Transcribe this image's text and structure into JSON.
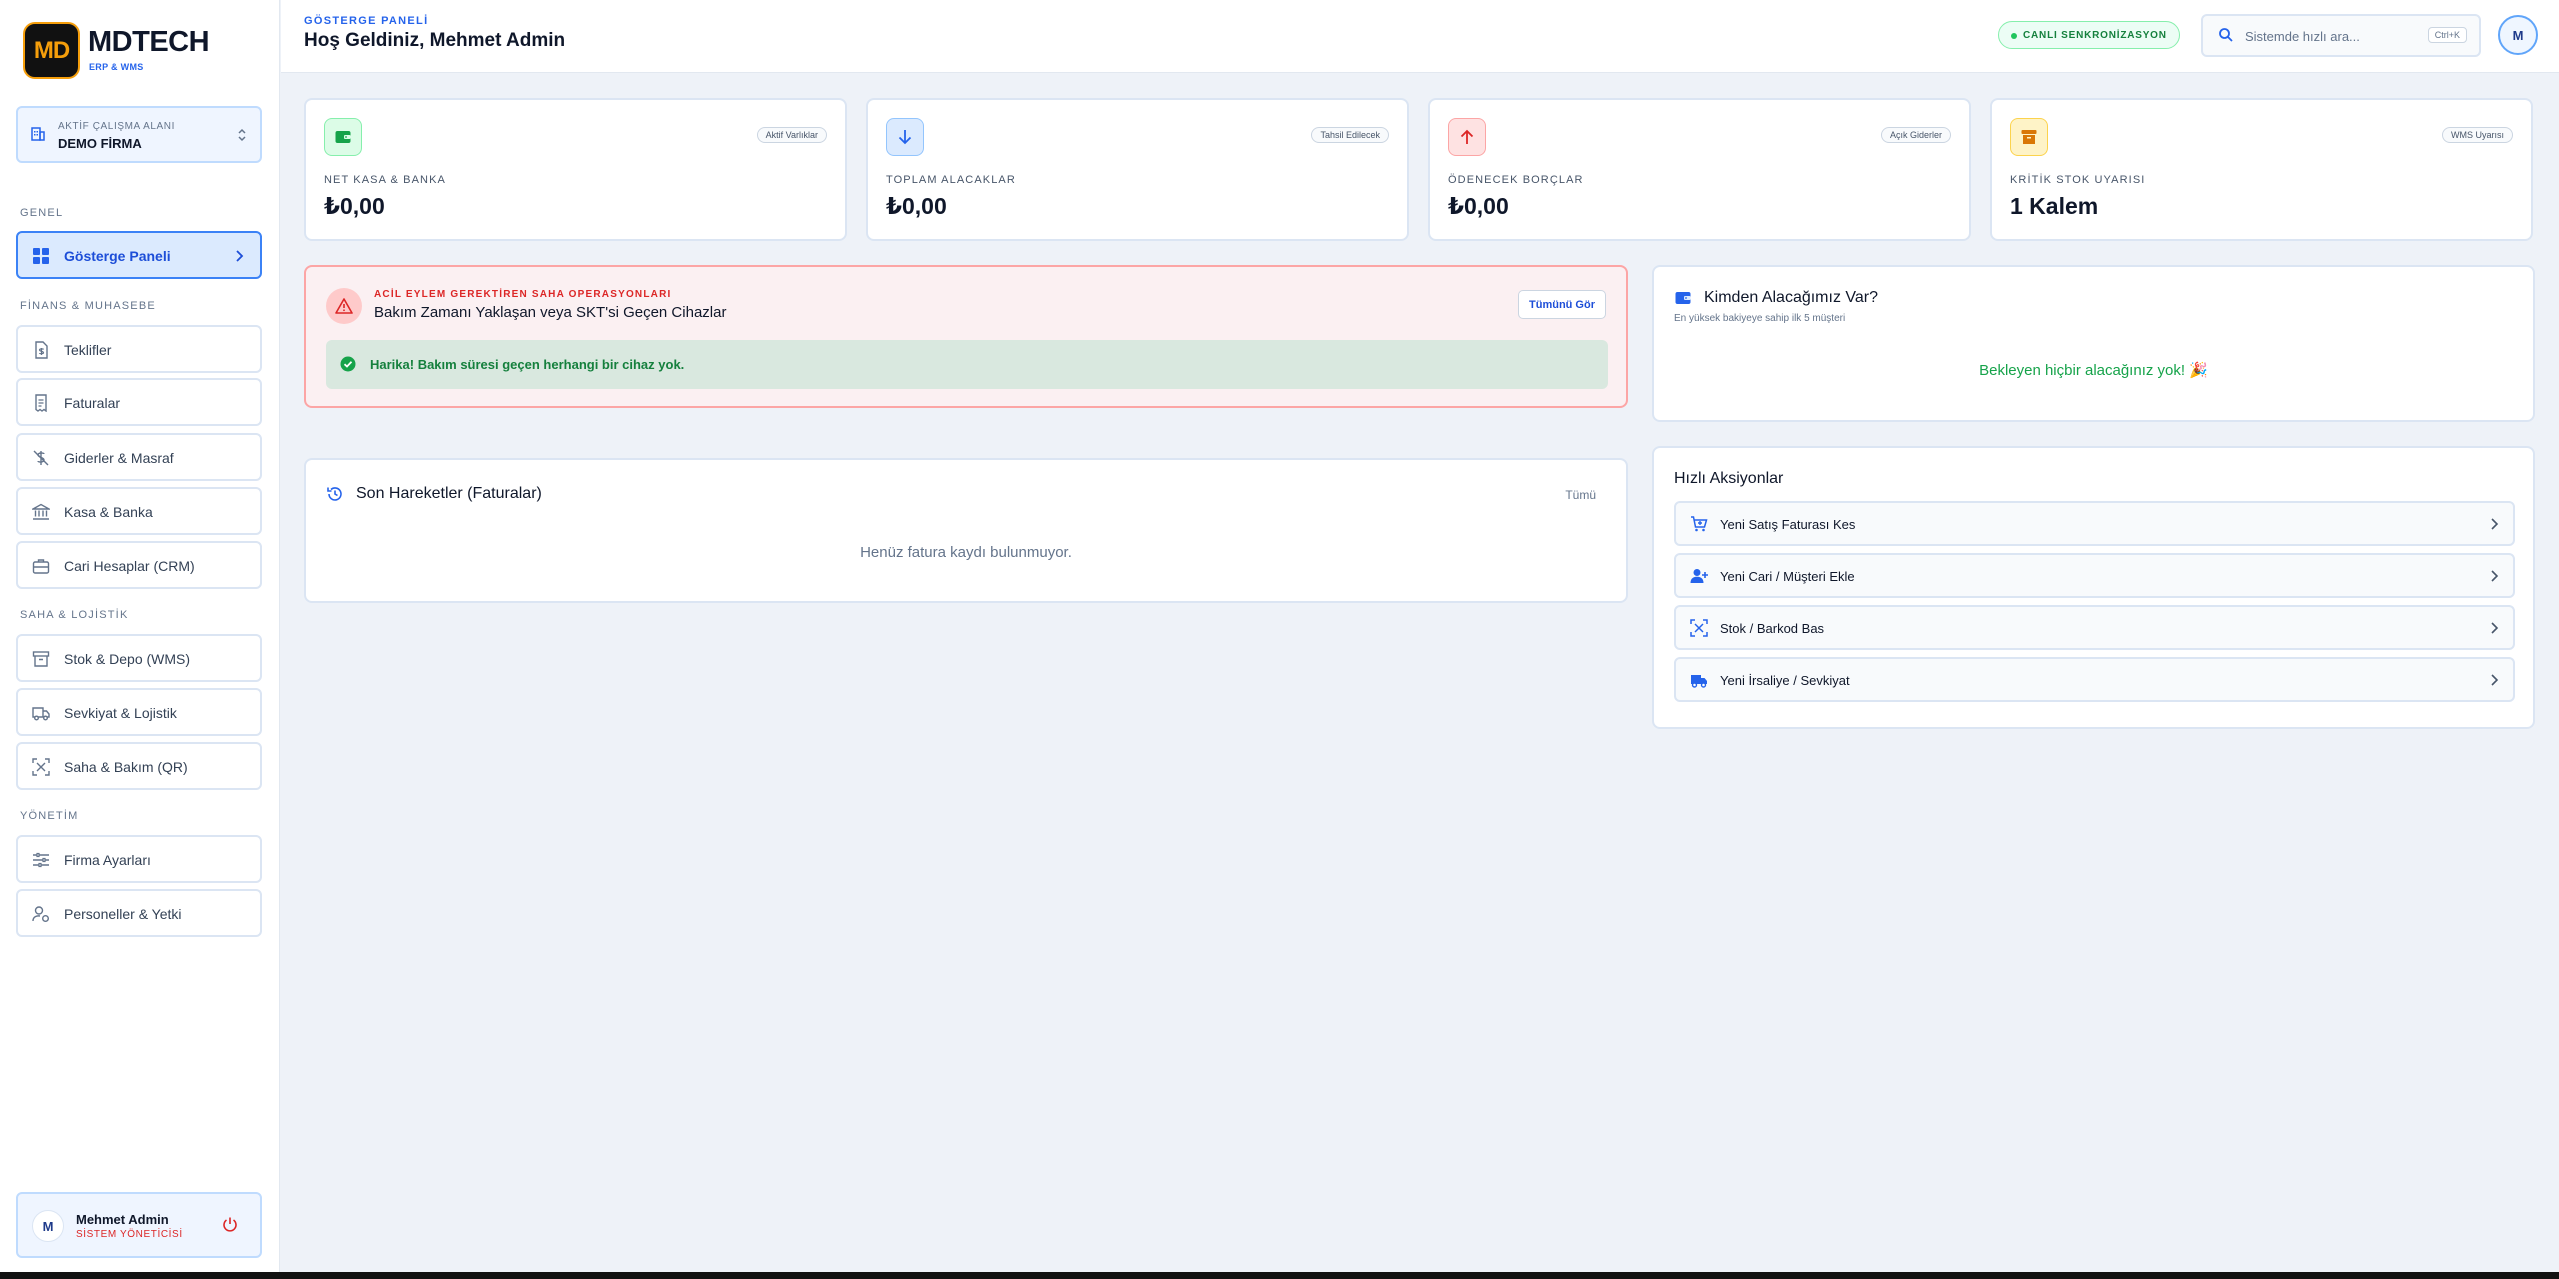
{
  "brand": {
    "logo_text": "MD",
    "name": "MDTECH",
    "sub": "ERP & WMS"
  },
  "workspace": {
    "label": "AKTİF ÇALIŞMA ALANI",
    "value": "DEMO FİRMA"
  },
  "sidebar": {
    "sections": [
      {
        "title": "GENEL"
      },
      {
        "title": "FİNANS & MUHASEBE"
      },
      {
        "title": "SAHA & LOJİSTİK"
      },
      {
        "title": "YÖNETİM"
      }
    ],
    "items": [
      {
        "label": "Gösterge Paneli",
        "icon": "dashboard-grid-icon",
        "active": true
      },
      {
        "label": "Teklifler",
        "icon": "document-dollar-icon"
      },
      {
        "label": "Faturalar",
        "icon": "receipt-icon"
      },
      {
        "label": "Giderler & Masraf",
        "icon": "dollar-off-icon"
      },
      {
        "label": "Kasa & Banka",
        "icon": "bank-icon"
      },
      {
        "label": "Cari Hesaplar (CRM)",
        "icon": "briefcase-icon"
      },
      {
        "label": "Stok & Depo (WMS)",
        "icon": "archive-box-icon"
      },
      {
        "label": "Sevkiyat & Lojistik",
        "icon": "truck-icon"
      },
      {
        "label": "Saha & Bakım (QR)",
        "icon": "scan-icon"
      },
      {
        "label": "Firma Ayarları",
        "icon": "sliders-icon"
      },
      {
        "label": "Personeller & Yetki",
        "icon": "user-cog-icon"
      }
    ]
  },
  "user": {
    "initial": "M",
    "name": "Mehmet Admin",
    "role": "SİSTEM YÖNETİCİSİ"
  },
  "header": {
    "crumb": "GÖSTERGE PANELİ",
    "title": "Hoş Geldiniz, Mehmet Admin",
    "sync": "CANLI SENKRONİZASYON",
    "search_placeholder": "Sistemde hızlı ara...",
    "shortcut": "Ctrl+K",
    "avatar": "M"
  },
  "stats": [
    {
      "label": "NET KASA & BANKA",
      "value": "₺0,00",
      "badge": "Aktif Varlıklar",
      "icon": "wallet-icon",
      "color": "#16a34a",
      "bg": "#dcfce7"
    },
    {
      "label": "TOPLAM ALACAKLAR",
      "value": "₺0,00",
      "badge": "Tahsil Edilecek",
      "icon": "arrow-down-icon",
      "color": "#2563eb",
      "bg": "#dbeafe"
    },
    {
      "label": "ÖDENECEK BORÇLAR",
      "value": "₺0,00",
      "badge": "Açık Giderler",
      "icon": "arrow-up-icon",
      "color": "#dc2626",
      "bg": "#fee2e2"
    },
    {
      "label": "KRİTİK STOK UYARISI",
      "value": "1 Kalem",
      "badge": "WMS Uyarısı",
      "icon": "archive-icon",
      "color": "#d97706",
      "bg": "#fef3c7"
    }
  ],
  "alert": {
    "eyebrow": "ACİL EYLEM GEREKTİREN SAHA OPERASYONLARI",
    "title": "Bakım Zamanı Yaklaşan veya SKT'si Geçen Cihazlar",
    "button": "Tümünü Gör",
    "ok_text": "Harika! Bakım süresi geçen herhangi bir cihaz yok."
  },
  "receivables": {
    "title": "Kimden Alacağımız Var?",
    "subtitle": "En yüksek bakiyeye sahip ilk 5 müşteri",
    "empty": "Bekleyen hiçbir alacağınız yok! 🎉"
  },
  "recent": {
    "title": "Son Hareketler (Faturalar)",
    "link": "Tümü",
    "empty": "Henüz fatura kaydı bulunmuyor."
  },
  "quick_actions": {
    "title": "Hızlı Aksiyonlar",
    "items": [
      {
        "label": "Yeni Satış Faturası Kes",
        "icon": "cart-plus-icon"
      },
      {
        "label": "Yeni Cari / Müşteri Ekle",
        "icon": "user-plus-icon"
      },
      {
        "label": "Stok / Barkod Bas",
        "icon": "barcode-scan-icon"
      },
      {
        "label": "Yeni İrsaliye / Sevkiyat",
        "icon": "truck-icon"
      }
    ]
  },
  "colors": {
    "accent": "#2563eb",
    "brand_gold": "#f59e0b",
    "danger": "#dc2626",
    "success": "#16a34a"
  }
}
